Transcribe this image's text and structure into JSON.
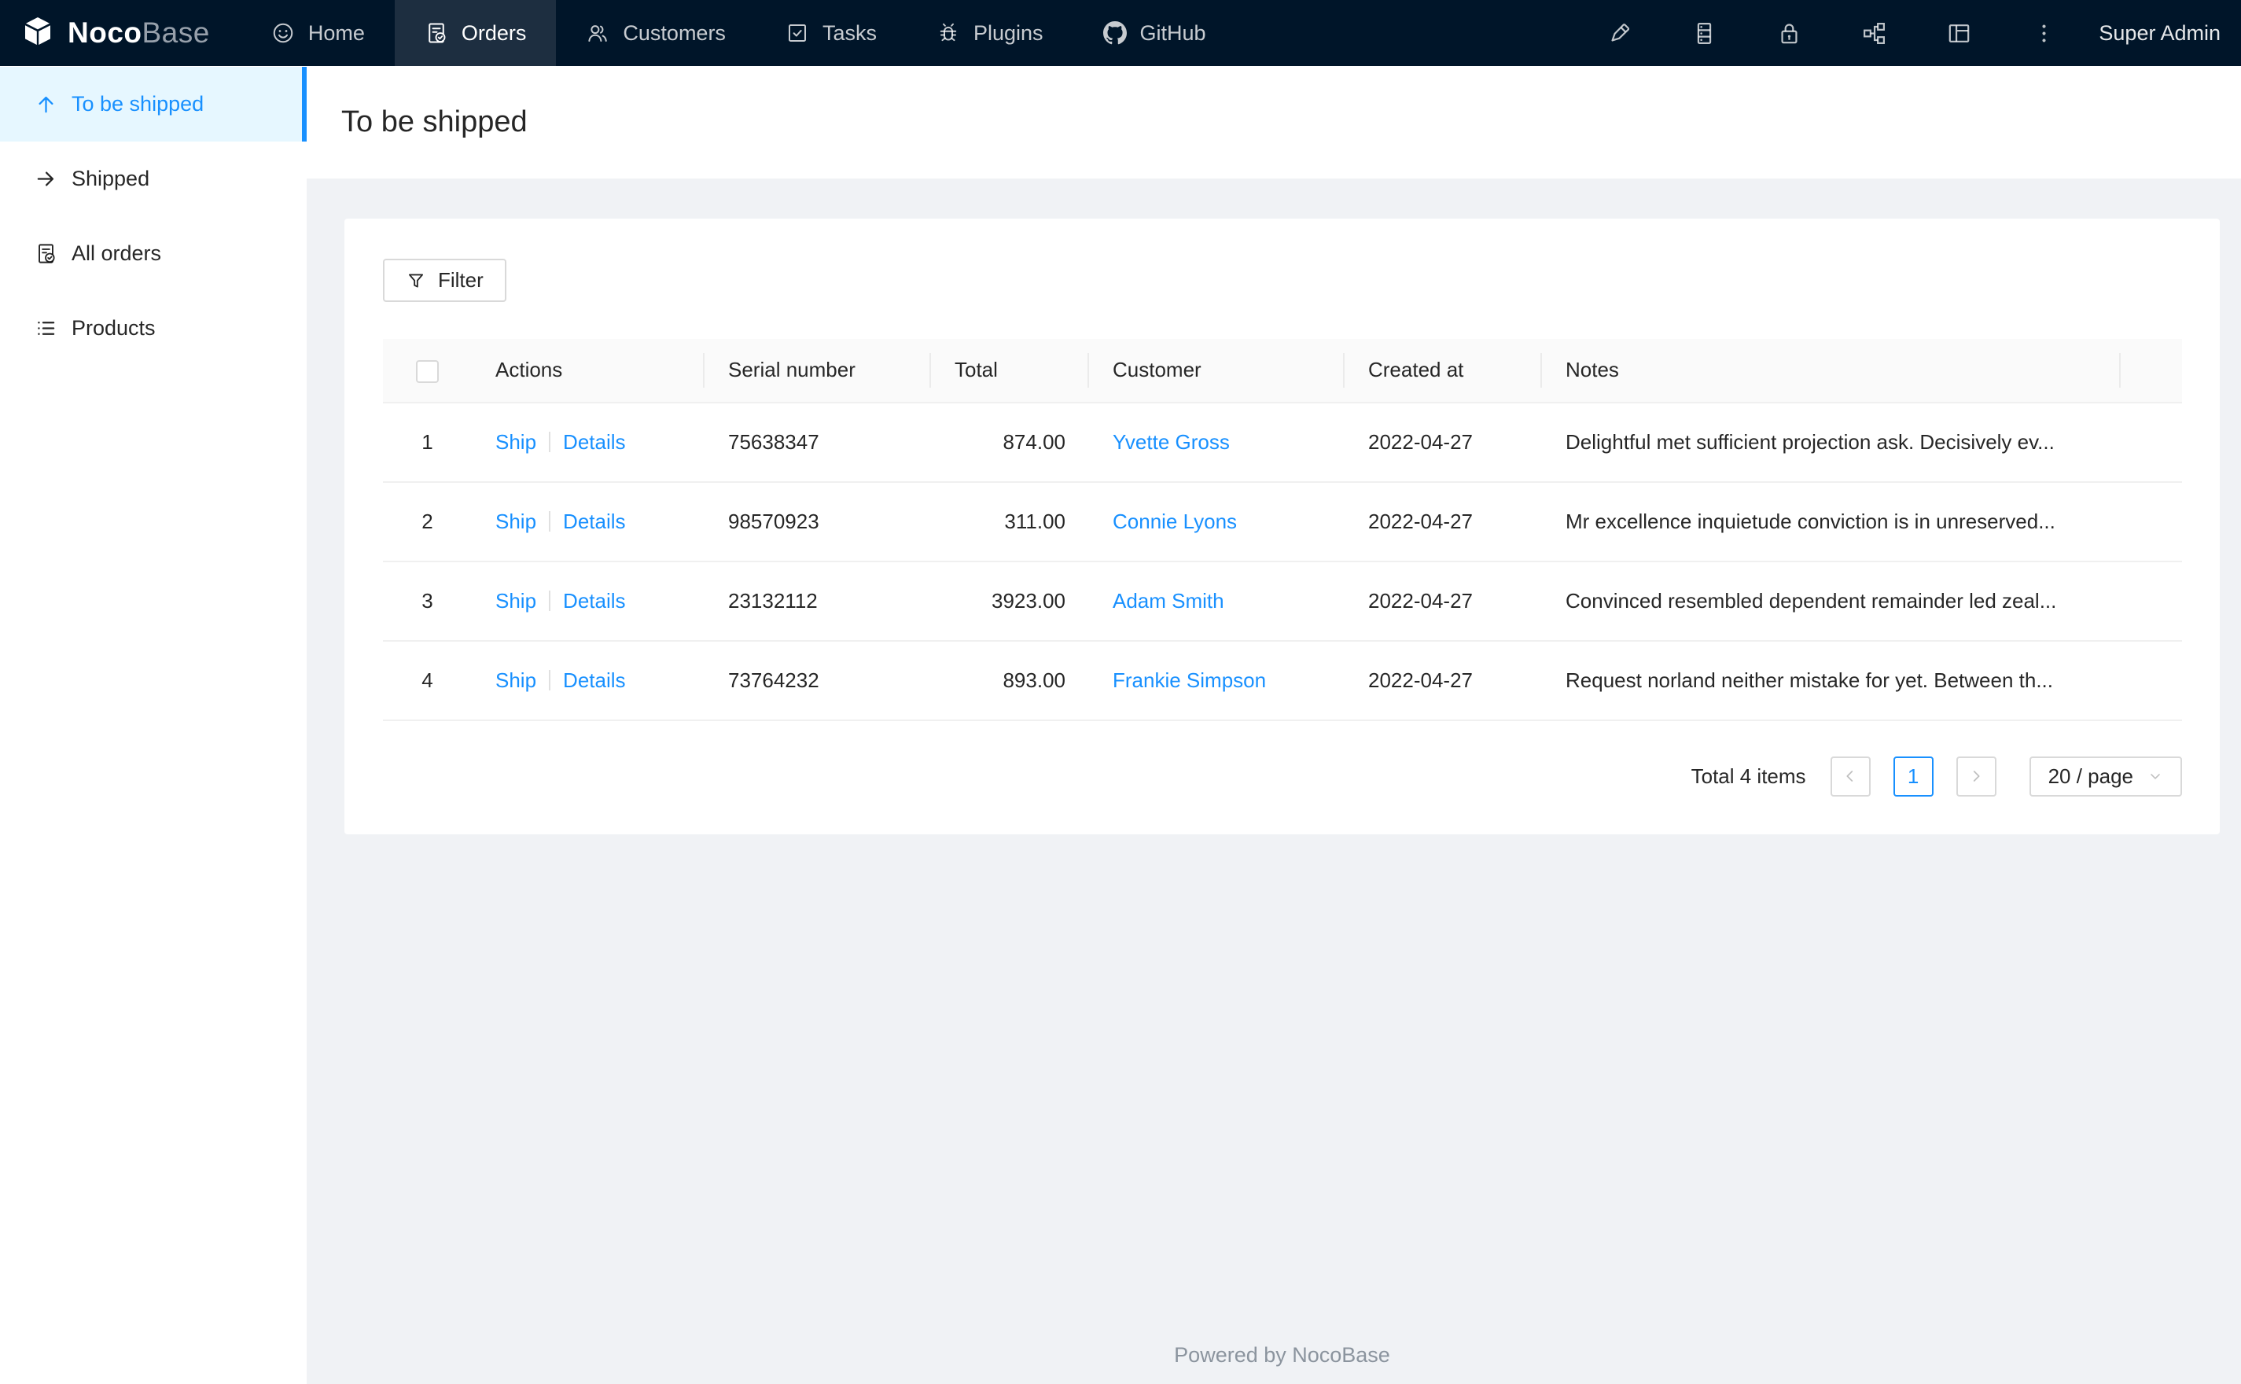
{
  "colors": {
    "navbar_bg": "#001529",
    "navbar_active_bg": "#1d2e40",
    "accent_blue": "#1890ff",
    "sidebar_selected_bg": "#e6f7ff",
    "content_bg": "#f0f2f5",
    "table_header_bg": "#fafafa",
    "border_light": "#f0f0f0"
  },
  "navbar": {
    "brand_bold": "Noco",
    "brand_light": "Base",
    "logo_icon": "nocobase-cube-icon",
    "items": [
      {
        "label": "Home",
        "icon": "smile-icon",
        "active": false
      },
      {
        "label": "Orders",
        "icon": "file-done-icon",
        "active": true
      },
      {
        "label": "Customers",
        "icon": "team-icon",
        "active": false
      },
      {
        "label": "Tasks",
        "icon": "check-square-icon",
        "active": false
      },
      {
        "label": "Plugins",
        "icon": "bug-icon",
        "active": false
      },
      {
        "label": "GitHub",
        "icon": "github-icon",
        "active": false
      }
    ],
    "right_icons": [
      "highlight-icon",
      "database-icon",
      "lock-icon",
      "partition-icon",
      "layout-icon",
      "ellipsis-vertical-icon"
    ],
    "user": "Super Admin"
  },
  "sidebar": {
    "items": [
      {
        "label": "To be shipped",
        "icon": "arrow-up-icon",
        "active": true
      },
      {
        "label": "Shipped",
        "icon": "arrow-right-icon",
        "active": false
      },
      {
        "label": "All orders",
        "icon": "file-done-icon",
        "active": false
      },
      {
        "label": "Products",
        "icon": "unordered-list-icon",
        "active": false
      }
    ]
  },
  "page": {
    "title": "To be shipped"
  },
  "toolbar": {
    "filter_label": "Filter",
    "filter_icon": "filter-funnel-icon"
  },
  "table": {
    "columns": [
      "Actions",
      "Serial number",
      "Total",
      "Customer",
      "Created at",
      "Notes"
    ],
    "action_labels": {
      "ship": "Ship",
      "details": "Details"
    },
    "rows": [
      {
        "index": "1",
        "serial": "75638347",
        "total": "874.00",
        "customer": "Yvette Gross",
        "created_at": "2022-04-27",
        "notes": "Delightful met sufficient projection ask. Decisively ev..."
      },
      {
        "index": "2",
        "serial": "98570923",
        "total": "311.00",
        "customer": "Connie Lyons",
        "created_at": "2022-04-27",
        "notes": "Mr excellence inquietude conviction is in unreserved..."
      },
      {
        "index": "3",
        "serial": "23132112",
        "total": "3923.00",
        "customer": "Adam Smith",
        "created_at": "2022-04-27",
        "notes": "Convinced resembled dependent remainder led zeal..."
      },
      {
        "index": "4",
        "serial": "73764232",
        "total": "893.00",
        "customer": "Frankie Simpson",
        "created_at": "2022-04-27",
        "notes": "Request norland neither mistake for yet. Between th..."
      }
    ]
  },
  "pagination": {
    "total_text": "Total 4 items",
    "current_page": "1",
    "page_size_label": "20 / page"
  },
  "footer": {
    "text": "Powered by NocoBase"
  }
}
